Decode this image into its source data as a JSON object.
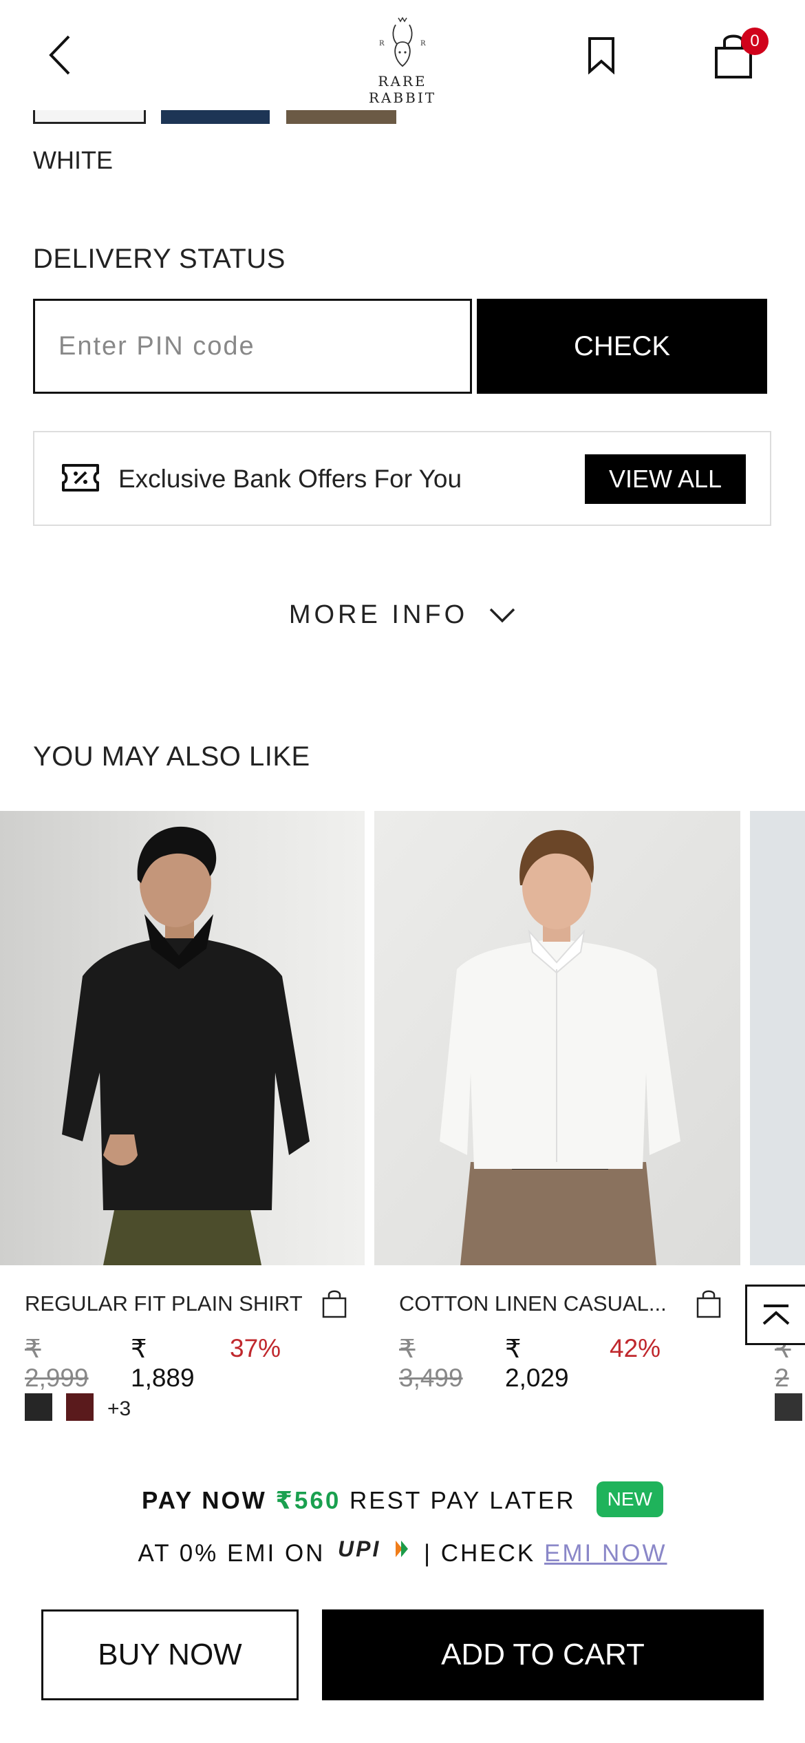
{
  "header": {
    "logo_text": "RARE RABBIT",
    "cart_count": "0"
  },
  "product": {
    "selected_color": "WHITE",
    "swatch_colors": [
      "#f4f4f4",
      "#1d3555",
      "#6b5a45"
    ]
  },
  "delivery": {
    "title": "DELIVERY STATUS",
    "pin_placeholder": "Enter PIN code",
    "check_label": "CHECK"
  },
  "offers": {
    "text": "Exclusive Bank Offers For You",
    "view_all_label": "VIEW ALL"
  },
  "more_info_label": "MORE INFO",
  "recommendations": {
    "title": "YOU MAY ALSO LIKE",
    "items": [
      {
        "name": "REGULAR FIT PLAIN SHIRT",
        "mrp": "₹ 2,999",
        "price": "₹ 1,889",
        "discount": "37%",
        "swatches": [
          "#262626",
          "#5a1a1c"
        ],
        "more_colors": "+3"
      },
      {
        "name": "COTTON LINEN CASUAL...",
        "mrp": "₹ 3,499",
        "price": "₹ 2,029",
        "discount": "42%"
      },
      {
        "mrp": "₹ 2",
        "swatches": [
          "#333333"
        ]
      }
    ]
  },
  "pay_later": {
    "line1_a": "PAY NOW",
    "line1_amount": "₹560",
    "line1_b": "REST PAY LATER",
    "new_badge": "NEW",
    "line2_a": "AT 0% EMI ON",
    "upi_logo": "UPI",
    "line2_b": "| CHECK",
    "emi_link": "EMI NOW"
  },
  "actions": {
    "buy_now": "BUY NOW",
    "add_to_cart": "ADD TO CART"
  },
  "colors": {
    "accent": "#000000",
    "discount": "#c0282d",
    "pay_amount": "#1aa04f",
    "badge_red": "#d0021b"
  }
}
